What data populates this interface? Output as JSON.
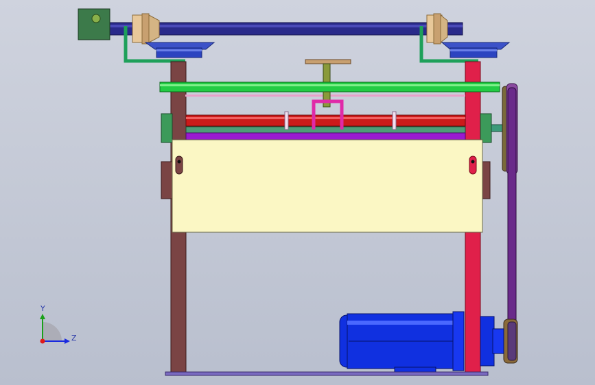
{
  "triad": {
    "y_label": "Y",
    "z_label": "Z"
  },
  "colors": {
    "background_top": "#cfd3de",
    "background_bottom": "#b9bfce",
    "frame_left": "#7a4444",
    "frame_right": "#e0204a",
    "top_shaft": "#2a2a8a",
    "gearbox": "#3c7a4a",
    "brackets": "#1ea05a",
    "bevel_gear": "#3c52c8",
    "pinion": "#e8c89a",
    "guide_rail": "#22cc44",
    "red_roller": "#cc1a1a",
    "green_roller": "#4f9c78",
    "purple_roller": "#9a1ad0",
    "housing": "#fbf7c4",
    "motor": "#1030e0",
    "belt": "#6a2a8a",
    "magenta_clamp": "#e02aa8",
    "base_plate": "#7a6ac0"
  }
}
